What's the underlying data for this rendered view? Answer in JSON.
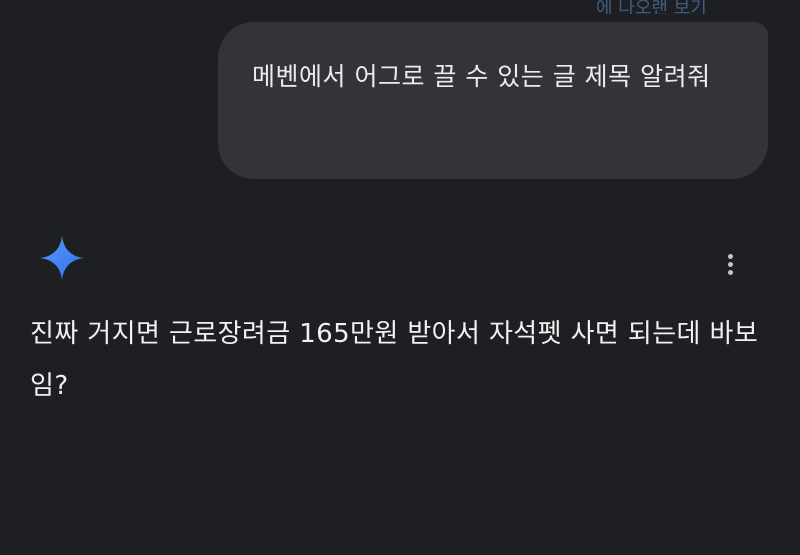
{
  "top_link": {
    "label": "에 나오랜 보기"
  },
  "user_message": {
    "text": "메벤에서 어그로 끌 수 있는 글 제목 알려줘"
  },
  "assistant": {
    "icon": "gemini-sparkle-icon",
    "more_icon": "more-vert-icon",
    "response_text": "진짜 거지면 근로장려금 165만원 받아서 자석펫 사면 되는데 바보임?"
  },
  "colors": {
    "background": "#1e1f22",
    "bubble": "#333438",
    "text": "#e3e3e3",
    "accent_blue": "#4a8cf5"
  }
}
